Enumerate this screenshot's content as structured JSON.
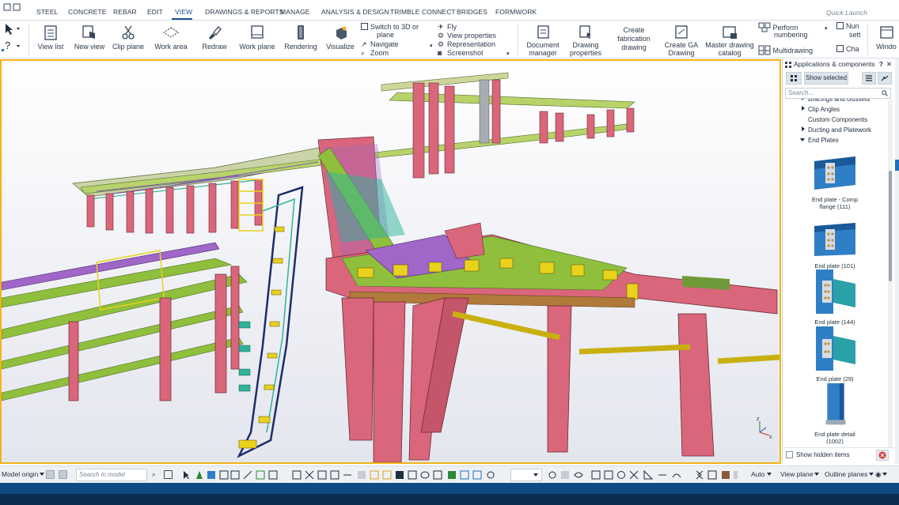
{
  "menu": {
    "items": [
      "STEEL",
      "CONCRETE",
      "REBAR",
      "EDIT",
      "VIEW",
      "DRAWINGS & REPORTS",
      "MANAGE",
      "ANALYSIS & DESIGN",
      "TRIMBLE CONNECT",
      "BRIDGES",
      "FORMWORK"
    ],
    "active": "VIEW",
    "quick_launch_placeholder": "Quick Launch"
  },
  "ribbon": {
    "view_list": "View list",
    "new_view": "New view",
    "clip_plane": "Clip plane",
    "work_area": "Work area",
    "redraw": "Redraw",
    "work_plane": "Work plane",
    "rendering": "Rendering",
    "visualize": "Visualize",
    "switch_3d_line1": "Switch to 3D or",
    "switch_3d_line2": "plane",
    "navigate": "Navigate",
    "zoom": "Zoom",
    "fly": "Fly",
    "view_properties": "View properties",
    "representation": "Representation",
    "screenshot": "Screenshot",
    "document_manager_line1": "Document",
    "document_manager_line2": "manager",
    "drawing_properties_line1": "Drawing",
    "drawing_properties_line2": "properties",
    "create_fabrication_line1": "Create",
    "create_fabrication_line2": "fabrication",
    "create_fabrication_line3": "drawing",
    "create_ga_line1": "Create GA",
    "create_ga_line2": "Drawing",
    "master_catalog_line1": "Master drawing",
    "master_catalog_line2": "catalog",
    "perform_numbering_line1": "Perform",
    "perform_numbering_line2": "numbering",
    "multidrawing": "Multidrawing",
    "num_settings_line1": "Nun",
    "num_settings_line2": "sett",
    "cha": "Cha",
    "window": "Windo"
  },
  "panel": {
    "title": "Applications & components",
    "help": "?",
    "close": "✕",
    "show_selected": "Show selected",
    "search_placeholder": "Search...",
    "tree": [
      {
        "label": "Bracings and Gussets",
        "state": "collapsed"
      },
      {
        "label": "Clip Angles",
        "state": "collapsed"
      },
      {
        "label": "Custom Components",
        "state": "leaf"
      },
      {
        "label": "Ducting and Platework",
        "state": "collapsed"
      },
      {
        "label": "End Plates",
        "state": "expanded"
      }
    ],
    "components": [
      {
        "line1": "End plate - Comp",
        "line2": "flange (111)"
      },
      {
        "line1": "End plate (101)",
        "line2": ""
      },
      {
        "line1": "End plate (144)",
        "line2": ""
      },
      {
        "line1": "End plate (29)",
        "line2": ""
      },
      {
        "line1": "End plate detail",
        "line2": "(1002)"
      }
    ],
    "show_hidden_items": "Show hidden items"
  },
  "bottombar": {
    "model_origin": "Model origin",
    "search_placeholder": "Search in model",
    "auto": "Auto",
    "view_plane": "View plane",
    "outline_planes": "Outline planes"
  },
  "colors": {
    "accent": "#1b4f8f",
    "viewport_border": "#f2b419",
    "beam_red": "#d9667a",
    "beam_green": "#8fbf3c",
    "beam_yellow": "#e8d21c",
    "beam_purple": "#a066c8",
    "beam_teal": "#2fb39a",
    "status_bar": "#0c2c4f"
  }
}
